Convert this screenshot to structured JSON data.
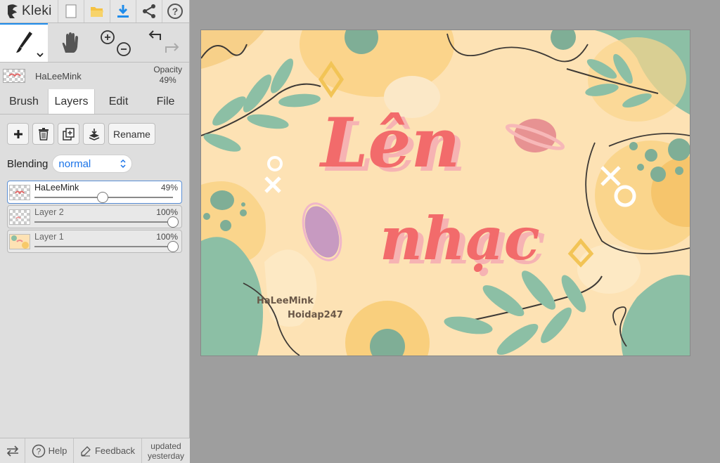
{
  "app": {
    "name": "Kleki"
  },
  "toolbar_icons": [
    "new-file-icon",
    "open-folder-icon",
    "download-icon",
    "share-icon",
    "help-icon"
  ],
  "current_layer": {
    "name": "HaLeeMink",
    "opacity_label": "Opacity",
    "opacity_value": "49%"
  },
  "tabs": [
    {
      "label": "Brush",
      "active": false
    },
    {
      "label": "Layers",
      "active": true
    },
    {
      "label": "Edit",
      "active": false
    },
    {
      "label": "File",
      "active": false
    }
  ],
  "layer_actions": {
    "rename_label": "Rename"
  },
  "blending": {
    "label": "Blending",
    "value": "normal"
  },
  "layers": [
    {
      "name": "HaLeeMink",
      "opacity": "49%",
      "level": 0.49,
      "selected": true
    },
    {
      "name": "Layer 2",
      "opacity": "100%",
      "level": 1.0,
      "selected": false
    },
    {
      "name": "Layer 1",
      "opacity": "100%",
      "level": 1.0,
      "selected": false
    }
  ],
  "footer": {
    "help_label": "Help",
    "feedback_label": "Feedback",
    "updated_line1": "updated",
    "updated_line2": "yesterday"
  },
  "artwork": {
    "title_line1": "Lên",
    "title_line2": "nhạc",
    "signature_1": "HaLeeMink",
    "signature_2": "Hoidap247"
  },
  "colors": {
    "accent": "#1f8ceb",
    "canvas_bg": "#fde2b4",
    "title": "#f26b6b",
    "leaf": "#8cbfa5"
  }
}
